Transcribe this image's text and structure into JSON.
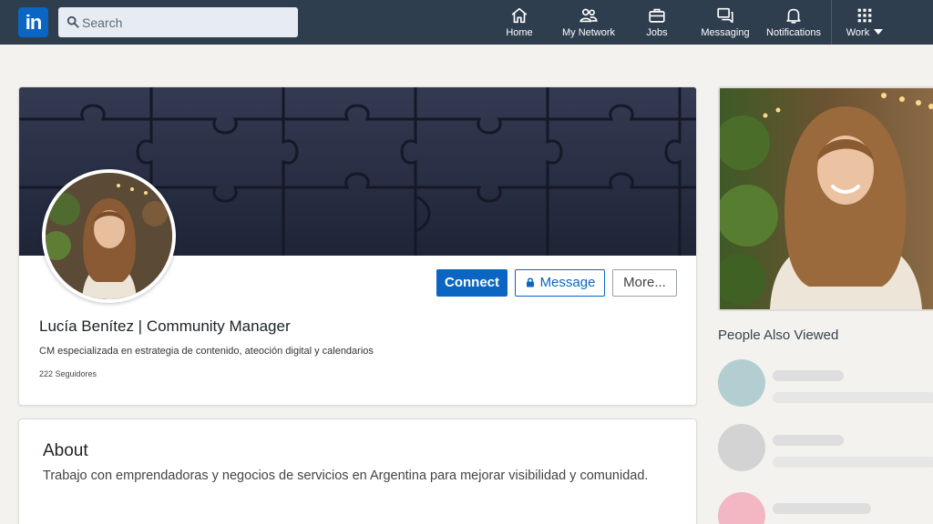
{
  "nav": {
    "logo_text": "in",
    "search": {
      "placeholder": "Search"
    },
    "items": [
      {
        "label": "Home",
        "icon": "home-icon"
      },
      {
        "label": "My Network",
        "icon": "network-icon"
      },
      {
        "label": "Jobs",
        "icon": "briefcase-icon"
      },
      {
        "label": "Messaging",
        "icon": "messaging-icon"
      },
      {
        "label": "Notifications",
        "icon": "bell-icon"
      },
      {
        "label": "Work",
        "icon": "grid-icon"
      }
    ]
  },
  "profile": {
    "name": "Lucía Benítez | Community Manager",
    "headline": "CM especializada en estrategia de contenido, ateoción digital y calendarios",
    "followers": "222 Seguidores",
    "actions": {
      "connect": "Connect",
      "message": "Message",
      "more": "More..."
    }
  },
  "about": {
    "title": "About",
    "text": "Trabajo con emprendadoras y negocios de servicios en Argentina para mejorar visibilidad y comunidad."
  },
  "sidebar": {
    "people_title": "People Also Viewed"
  },
  "colors": {
    "nav_bg": "#2f3e4e",
    "brand": "#0a66c2",
    "cover": "#262d42",
    "people_avatars": [
      "#b3ced1",
      "#d3d3d3",
      "#f2b7c2"
    ]
  }
}
